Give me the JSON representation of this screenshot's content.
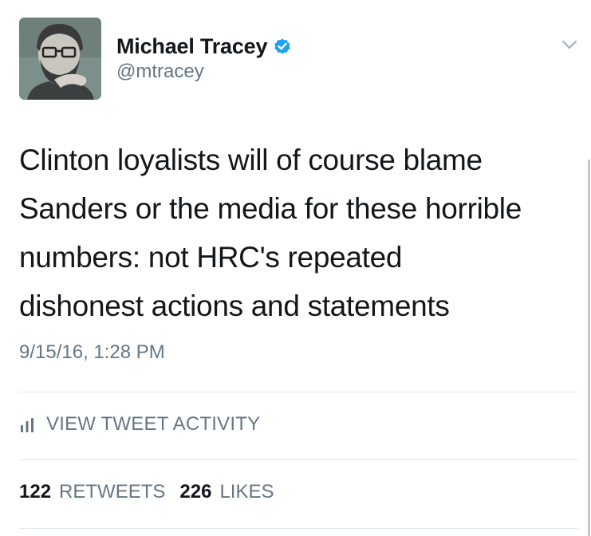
{
  "user": {
    "display_name": "Michael Tracey",
    "handle": "@mtracey",
    "verified_icon": "verified-badge-icon",
    "avatar_icon": "avatar"
  },
  "tweet": {
    "lines": [
      "Clinton loyalists will of course blame",
      "Sanders or the media for these horrible",
      "numbers: not HRC's repeated",
      "dishonest actions and statements"
    ],
    "timestamp": "9/15/16, 1:28 PM"
  },
  "activity": {
    "label": "VIEW TWEET ACTIVITY",
    "icon": "bar-chart-icon"
  },
  "stats": {
    "retweets_count": "122",
    "retweets_label": "RETWEETS",
    "likes_count": "226",
    "likes_label": "LIKES"
  },
  "menu": {
    "icon": "chevron-down-icon"
  },
  "colors": {
    "text_primary": "#14171a",
    "text_secondary": "#657786",
    "verified_blue": "#1da1f2",
    "divider": "#e1e8ed"
  }
}
